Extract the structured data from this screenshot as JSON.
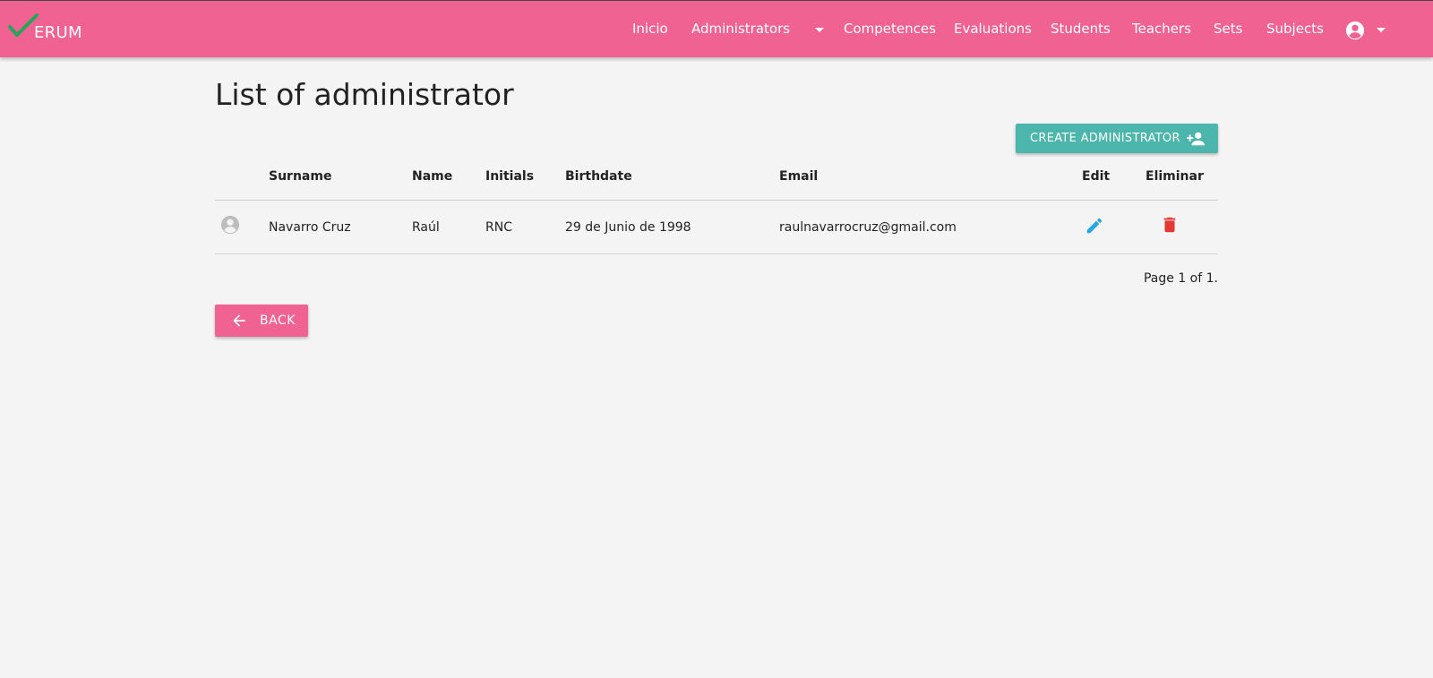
{
  "brand": {
    "logo_text": "ERUM",
    "check_color": "#26a65b",
    "navbar_color": "#f06292"
  },
  "nav": {
    "items": [
      "Inicio",
      "Administrators",
      "Competences",
      "Evaluations",
      "Students",
      "Teachers",
      "Sets",
      "Subjects"
    ],
    "administrators_dropdown_icon": "caret-down-icon",
    "account_icon": "account-circle-icon",
    "account_dropdown_icon": "caret-down-icon"
  },
  "page": {
    "title": "List of administrator"
  },
  "actions": {
    "create_label": "CREATE ADMINISTRATOR",
    "create_icon": "person-add-icon",
    "create_color": "#4db6ac",
    "back_label": "BACK",
    "back_icon": "arrow-left-icon"
  },
  "table": {
    "columns": [
      "",
      "Surname",
      "Name",
      "Initials",
      "Birthdate",
      "Email",
      "Edit",
      "Eliminar"
    ],
    "rows": [
      {
        "avatar_icon": "account-circle-icon",
        "surname": "Navarro Cruz",
        "name": "Raúl",
        "initials": "RNC",
        "birthdate": "29 de Junio de 1998",
        "email": "raulnavarrocruz@gmail.com",
        "edit_icon": "pencil-icon",
        "delete_icon": "trash-icon"
      }
    ],
    "edit_color": "#29a8e0",
    "delete_color": "#e53935"
  },
  "pagination": {
    "text": "Page 1 of 1."
  }
}
